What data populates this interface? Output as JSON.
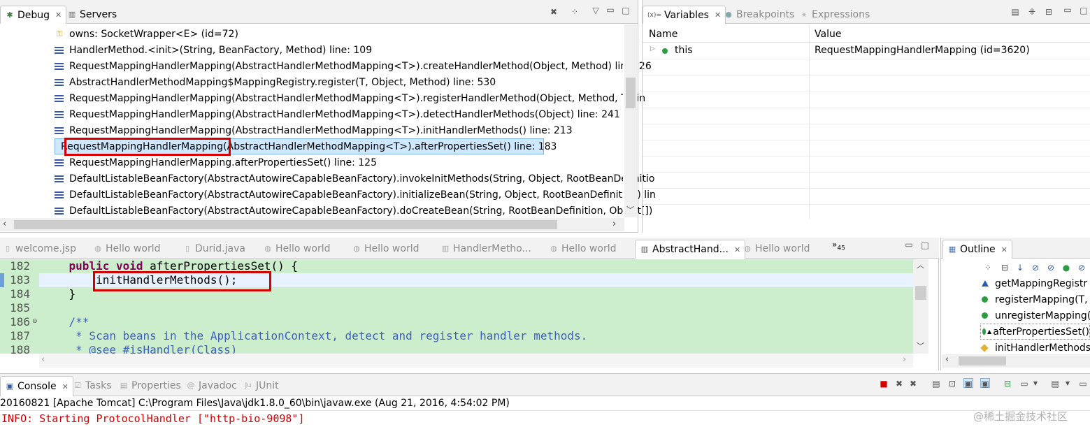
{
  "debug_view": {
    "tabs": [
      {
        "label": "Debug",
        "icon": "bug-icon"
      },
      {
        "label": "Servers",
        "icon": "servers-icon"
      }
    ],
    "frames": [
      {
        "label": "owns: SocketWrapper<E>  (id=72)",
        "icon": "key-icon"
      },
      {
        "label": "HandlerMethod.<init>(String, BeanFactory, Method) line: 109"
      },
      {
        "label": "RequestMappingHandlerMapping(AbstractHandlerMethodMapping<T>).createHandlerMethod(Object, Method) line: 26"
      },
      {
        "label": "AbstractHandlerMethodMapping$MappingRegistry.register(T, Object, Method) line: 530"
      },
      {
        "label": "RequestMappingHandlerMapping(AbstractHandlerMethodMapping<T>).registerHandlerMethod(Object, Method, T) lin"
      },
      {
        "label": "RequestMappingHandlerMapping(AbstractHandlerMethodMapping<T>).detectHandlerMethods(Object) line: 241"
      },
      {
        "label": "RequestMappingHandlerMapping(AbstractHandlerMethodMapping<T>).initHandlerMethods() line: 213"
      },
      {
        "label": "RequestMappingHandlerMapping(AbstractHandlerMethodMapping<T>).afterPropertiesSet() line: 183",
        "selected": true
      },
      {
        "label": "RequestMappingHandlerMapping.afterPropertiesSet() line: 125"
      },
      {
        "label": "DefaultListableBeanFactory(AbstractAutowireCapableBeanFactory).invokeInitMethods(String, Object, RootBeanDefinitio"
      },
      {
        "label": "DefaultListableBeanFactory(AbstractAutowireCapableBeanFactory).initializeBean(String, Object, RootBeanDefinition) lin"
      },
      {
        "label": "DefaultListableBeanFactory(AbstractAutowireCapableBeanFactory).doCreateBean(String, RootBeanDefinition, Object[])"
      }
    ]
  },
  "variables_view": {
    "tabs": [
      {
        "label": "Variables",
        "icon": "variables-icon"
      },
      {
        "label": "Breakpoints",
        "icon": "breakpoints-icon"
      },
      {
        "label": "Expressions",
        "icon": "expressions-icon"
      }
    ],
    "columns": [
      "Name",
      "Value"
    ],
    "rows": [
      {
        "name": "this",
        "value": "RequestMappingHandlerMapping  (id=3620)"
      }
    ]
  },
  "editor": {
    "tabs": [
      {
        "label": "welcome.jsp"
      },
      {
        "label": "Hello world"
      },
      {
        "label": "Durid.java"
      },
      {
        "label": "Hello world"
      },
      {
        "label": "Hello world"
      },
      {
        "label": "HandlerMetho..."
      },
      {
        "label": "Hello world"
      },
      {
        "label": "AbstractHand...",
        "active": true
      },
      {
        "label": "Hello world"
      }
    ],
    "overflow_count": "45",
    "lines": [
      {
        "num": "182",
        "tokens": [
          {
            "t": "    "
          },
          {
            "t": "public",
            "k": true
          },
          {
            "t": " "
          },
          {
            "t": "void",
            "k": true
          },
          {
            "t": " afterPropertiesSet() {"
          }
        ]
      },
      {
        "num": "183",
        "tokens": [
          {
            "t": "        initHandlerMethods();"
          }
        ],
        "current": true
      },
      {
        "num": "184",
        "tokens": [
          {
            "t": "    }"
          }
        ]
      },
      {
        "num": "185",
        "tokens": [
          {
            "t": ""
          }
        ]
      },
      {
        "num": "186",
        "tokens": [
          {
            "t": "    /**",
            "c": true
          }
        ],
        "fold": true
      },
      {
        "num": "187",
        "tokens": [
          {
            "t": "     * Scan beans in the ApplicationContext, detect and register handler methods.",
            "c": true
          }
        ]
      },
      {
        "num": "188",
        "tokens": [
          {
            "t": "     * @see #isHandler(Class)",
            "c": true
          }
        ]
      }
    ]
  },
  "outline": {
    "title": "Outline",
    "items": [
      {
        "label": "getMappingRegistr",
        "icon": "protected-method-icon"
      },
      {
        "label": "registerMapping(T,",
        "icon": "public-method-icon"
      },
      {
        "label": "unregisterMapping(",
        "icon": "public-method-icon"
      },
      {
        "label": "afterPropertiesSet()",
        "icon": "public-method-icon",
        "selected": true
      },
      {
        "label": "initHandlerMethods",
        "icon": "protected-method-icon"
      }
    ]
  },
  "console": {
    "tabs": [
      {
        "label": "Console"
      },
      {
        "label": "Tasks"
      },
      {
        "label": "Properties"
      },
      {
        "label": "Javadoc"
      },
      {
        "label": "JUnit"
      }
    ],
    "process": "20160821 [Apache Tomcat] C:\\Program Files\\Java\\jdk1.8.0_60\\bin\\javaw.exe (Aug 21, 2016, 4:54:02 PM)",
    "output": "INFO: Starting ProtocolHandler [\"http-bio-9098\"]"
  },
  "watermark": "@稀土掘金技术社区",
  "colors": {
    "highlight_red": "#d40000",
    "editor_bg": "#cceecc",
    "selection": "#cde8ff",
    "console_red": "#d00000"
  }
}
